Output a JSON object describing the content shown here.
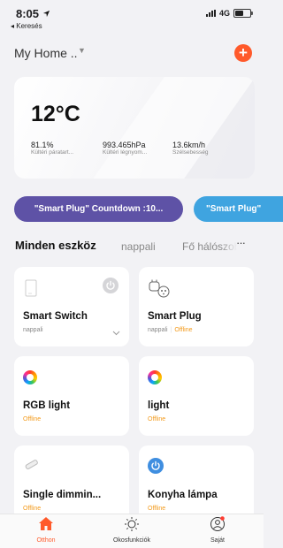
{
  "status_bar": {
    "time": "8:05",
    "back_label": "◂ Keresés",
    "network": "4G"
  },
  "header": {
    "home_name": "My Home ..",
    "add_label": "+"
  },
  "weather": {
    "temperature": "12°C",
    "metrics": [
      {
        "value": "81.1%",
        "label": "Kültéri páratart..."
      },
      {
        "value": "993.465hPa",
        "label": "Kültéri légnyom..."
      },
      {
        "value": "13.6km/h",
        "label": "Szélsebesség"
      }
    ]
  },
  "scenes": [
    {
      "label": "\"Smart Plug\" Countdown :10..."
    },
    {
      "label": "\"Smart Plug\""
    }
  ],
  "tabs": {
    "all": "Minden eszköz",
    "nappali": "nappali",
    "main": "Fő hálószoba",
    "more": "···"
  },
  "devices": [
    {
      "name": "Smart Switch",
      "room": "nappali",
      "status": ""
    },
    {
      "name": "Smart Plug",
      "room": "nappali",
      "status": "Offline"
    },
    {
      "name": "RGB light",
      "room": "",
      "status": "Offline"
    },
    {
      "name": "light",
      "room": "",
      "status": "Offline"
    },
    {
      "name": "Single dimmin...",
      "room": "",
      "status": "Offline"
    },
    {
      "name": "Konyha lámpa",
      "room": "",
      "status": "Offline"
    }
  ],
  "nav": {
    "home": "Otthon",
    "smart": "Okosfunkciók",
    "me": "Saját",
    "colors": {
      "active": "#ff5a2b",
      "inactive": "#333333"
    }
  },
  "colors": {
    "accent": "#ff5a2b",
    "scene1": "#5e52a6",
    "scene2": "#3fa4e0",
    "offline": "#f39a1b",
    "power_active": "#3f8ee0"
  }
}
